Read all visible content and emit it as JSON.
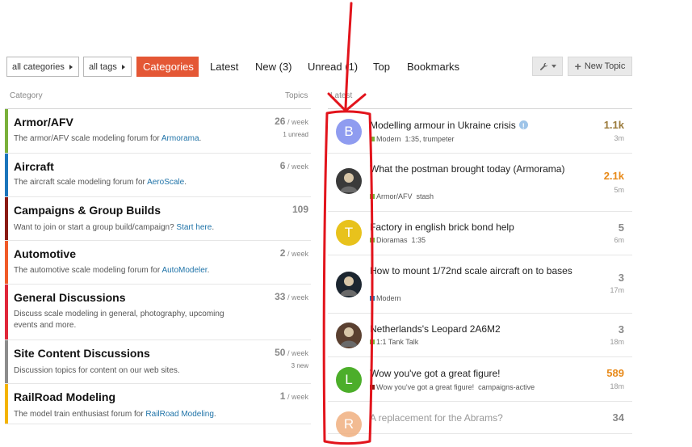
{
  "nav": {
    "category_dropdown": "all categories",
    "tags_dropdown": "all tags",
    "tabs": [
      {
        "label": "Categories",
        "active": true
      },
      {
        "label": "Latest"
      },
      {
        "label": "New (3)"
      },
      {
        "label": "Unread (1)"
      },
      {
        "label": "Top"
      },
      {
        "label": "Bookmarks"
      }
    ],
    "tools_icon": "wrench-icon",
    "new_topic_label": "New Topic"
  },
  "headers": {
    "category": "Category",
    "topics": "Topics",
    "latest": "Latest"
  },
  "categories": [
    {
      "name": "Armor/AFV",
      "desc": "The armor/AFV scale modeling forum for ",
      "link": "Armorama",
      "tail": ".",
      "count": "26",
      "unit": " / week",
      "sub": "1 unread",
      "color": "#7ab03a"
    },
    {
      "name": "Aircraft",
      "desc": "The aircraft scale modeling forum for ",
      "link": "AeroScale",
      "tail": ".",
      "count": "6",
      "unit": " / week",
      "sub": "",
      "color": "#1b75bb"
    },
    {
      "name": "Campaigns & Group Builds",
      "desc": "Want to join or start a group build/campaign? ",
      "link": "Start here",
      "tail": ".",
      "count": "109",
      "unit": "",
      "sub": "",
      "color": "#8a1b14"
    },
    {
      "name": "Automotive",
      "desc": "The automotive scale modeling forum for ",
      "link": "AutoModeler",
      "tail": ".",
      "count": "2",
      "unit": " / week",
      "sub": "",
      "color": "#f05a28"
    },
    {
      "name": "General Discussions",
      "desc": "Discuss scale modeling in general, photography, upcoming events and more.",
      "link": "",
      "tail": "",
      "count": "33",
      "unit": " / week",
      "sub": "",
      "color": "#e0273a"
    },
    {
      "name": "Site Content Discussions",
      "desc": "Discussion topics for content on our web sites.",
      "link": "",
      "tail": "",
      "count": "50",
      "unit": " / week",
      "sub": "3 new",
      "color": "#8c8c8c"
    },
    {
      "name": "RailRoad Modeling",
      "desc": "The model train enthusiast forum for ",
      "link": "RailRoad Modeling",
      "tail": ".",
      "count": "1",
      "unit": " / week",
      "sub": "",
      "color": "#f4b400"
    }
  ],
  "topics": [
    {
      "title": "Modelling armour in Ukraine crisis",
      "pinned_info": true,
      "cat": "Modern",
      "cat_color": "#7ab03a",
      "tags": "1:35, trumpeter",
      "views": "1.1k",
      "views_color": "#9b7b3c",
      "age": "3m",
      "avatar_letter": "B",
      "avatar_color": "#8f9cf0"
    },
    {
      "title": "What the postman brought today (Armorama)",
      "pinned_info": false,
      "cat": "Armor/AFV",
      "cat_color": "#7ab03a",
      "tags": "stash",
      "views": "2.1k",
      "views_color": "#e88a1a",
      "age": "5m",
      "avatar_letter": "",
      "avatar_color": "#3a3a3a"
    },
    {
      "title": "Factory in english brick bond help",
      "pinned_info": false,
      "cat": "Dioramas",
      "cat_color": "#7ab03a",
      "tags": "1:35",
      "views": "5",
      "views_color": "#888888",
      "age": "6m",
      "avatar_letter": "T",
      "avatar_color": "#e8c21c"
    },
    {
      "title": "How to mount 1/72nd scale aircraft on to bases",
      "pinned_info": false,
      "cat": "Modern",
      "cat_color": "#1b75bb",
      "tags": "",
      "views": "3",
      "views_color": "#888888",
      "age": "17m",
      "avatar_letter": "",
      "avatar_color": "#1c2630"
    },
    {
      "title": "Netherlands's Leopard 2A6M2",
      "pinned_info": false,
      "cat": "1:1 Tank Talk",
      "cat_color": "#7ab03a",
      "tags": "",
      "views": "3",
      "views_color": "#888888",
      "age": "18m",
      "avatar_letter": "",
      "avatar_color": "#5a4030"
    },
    {
      "title": "Wow you've got a great figure!",
      "pinned_info": false,
      "cat": "Wow you've got a great figure!",
      "cat_color": "#8a1b14",
      "tags": "campaigns-active",
      "views": "589",
      "views_color": "#e88a1a",
      "age": "18m",
      "avatar_letter": "L",
      "avatar_color": "#4cae2a"
    },
    {
      "title": "A replacement for the Abrams?",
      "pinned_info": false,
      "cat": "",
      "cat_color": "#7ab03a",
      "tags": "",
      "views": "34",
      "views_color": "#888888",
      "age": "",
      "avatar_letter": "R",
      "avatar_color": "#f0b080"
    }
  ]
}
